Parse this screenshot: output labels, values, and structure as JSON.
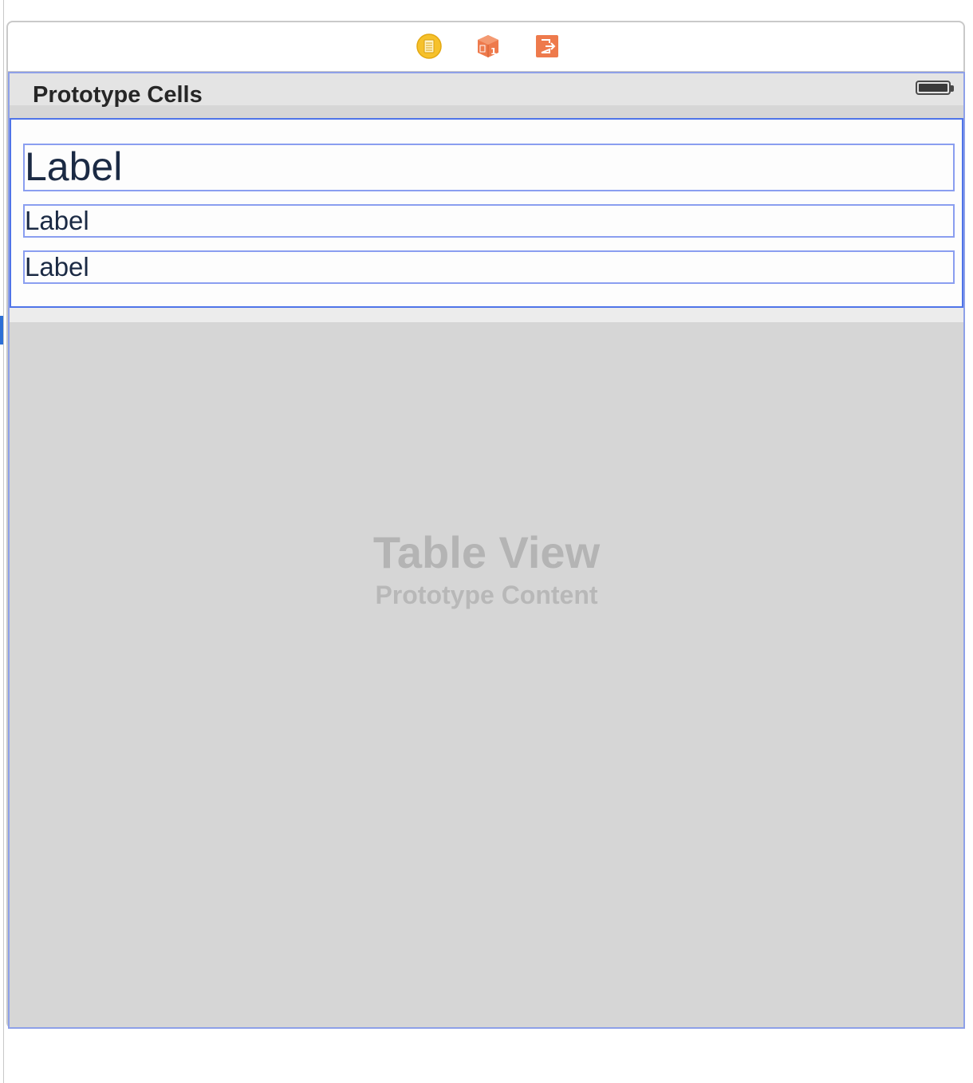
{
  "scene_dock": {
    "icons": [
      {
        "name": "view-controller-icon",
        "color": "#f6c12b"
      },
      {
        "name": "first-responder-icon",
        "color": "#ee7a4c",
        "glyph": "1"
      },
      {
        "name": "exit-icon",
        "color": "#ee7a4c"
      }
    ]
  },
  "table": {
    "section_header": "Prototype Cells",
    "cell": {
      "labels": [
        "Label",
        "Label",
        "Label"
      ]
    },
    "placeholder": {
      "title": "Table View",
      "subtitle": "Prototype Content"
    }
  },
  "colors": {
    "selection_border": "#4f74e8",
    "label_border": "#8a9ef0",
    "table_background": "#d6d6d6"
  }
}
